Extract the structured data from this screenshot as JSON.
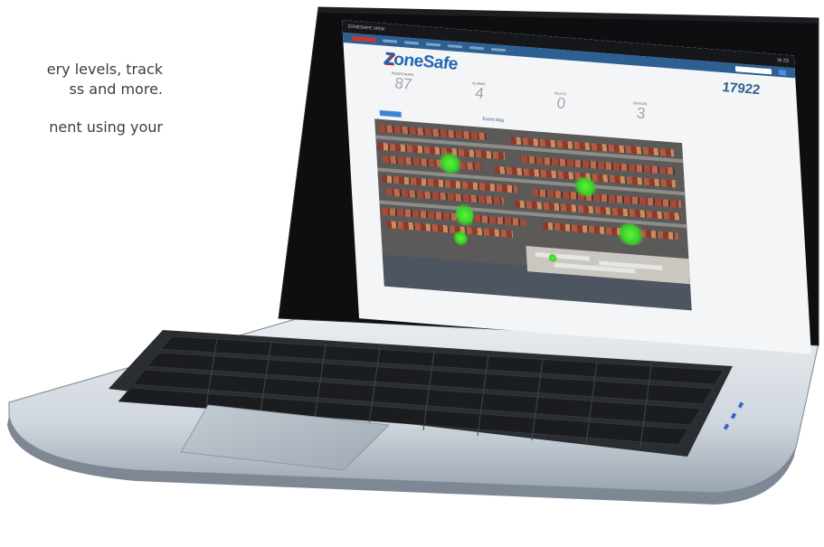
{
  "marketing_copy": {
    "line1": "ery levels, track",
    "line2": "ss and more.",
    "line3": "nent using your"
  },
  "app": {
    "window_title": "ZONESAFE VIEW",
    "window_status": "IN ZS",
    "brand": {
      "logo_first": "Z",
      "logo_rest": "oneSafe"
    },
    "big_number": "17922",
    "stats": [
      {
        "label": "PEDESTRIANS",
        "value": "87"
      },
      {
        "label": "ALARMS",
        "value": "4"
      },
      {
        "label": "FAULTS",
        "value": "0"
      },
      {
        "label": "DEVICES",
        "value": "3"
      }
    ],
    "map": {
      "title": "Event Map"
    }
  },
  "colors": {
    "brand_blue": "#1f67b0",
    "nav_blue": "#2d5f91",
    "heat_green": "#3bd22a"
  }
}
